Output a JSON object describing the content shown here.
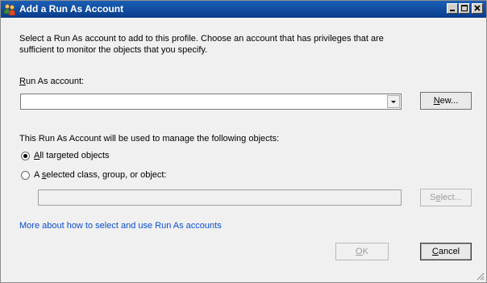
{
  "window": {
    "title": "Add a Run As Account"
  },
  "intro": {
    "line1": "Select a Run As account to add to this profile.  Choose an account that has privileges that are",
    "line2": "sufficient to monitor the objects that you specify."
  },
  "run_as": {
    "label_accel": "R",
    "label_rest": "un As account:",
    "value": ""
  },
  "buttons": {
    "new_accel": "N",
    "new_rest": "ew...",
    "select_pre": "S",
    "select_accel": "e",
    "select_rest": "lect...",
    "ok_accel": "O",
    "ok_rest": "K",
    "cancel_accel": "C",
    "cancel_rest": "ancel"
  },
  "scope": {
    "heading": "This Run As Account will be used to manage the following objects:",
    "option_all_accel": "A",
    "option_all_rest": "ll targeted objects",
    "option_selected_pre": "A ",
    "option_selected_accel": "s",
    "option_selected_rest": "elected class, group, or object:",
    "selected_option": "all",
    "selected_value": ""
  },
  "help_link": "More about how to select and use Run As accounts",
  "colors": {
    "title_bar": "#0a3c8c",
    "link": "#0b4fd3"
  }
}
